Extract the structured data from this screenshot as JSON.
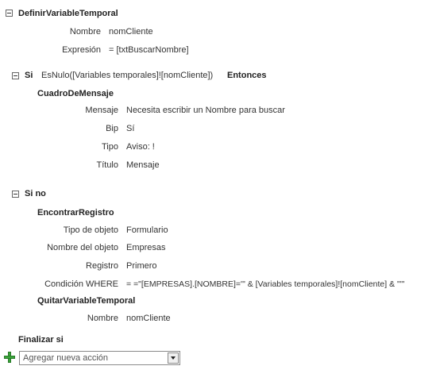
{
  "block1": {
    "action": "DefinirVariableTemporal",
    "nombre_label": "Nombre",
    "nombre_value": "nomCliente",
    "expresion_label": "Expresión",
    "expresion_value": "= [txtBuscarNombre]"
  },
  "if_block": {
    "keyword": "Si",
    "condition": "EsNulo([Variables temporales]![nomCliente])",
    "then_keyword": "Entonces",
    "action": "CuadroDeMensaje",
    "mensaje_label": "Mensaje",
    "mensaje_value": "Necesita escribir un Nombre para buscar",
    "bip_label": "Bip",
    "bip_value": "Sí",
    "tipo_label": "Tipo",
    "tipo_value": "Aviso: !",
    "titulo_label": "Título",
    "titulo_value": "Mensaje"
  },
  "else_block": {
    "keyword": "Si no",
    "action1": "EncontrarRegistro",
    "tipo_objeto_label": "Tipo de objeto",
    "tipo_objeto_value": "Formulario",
    "nombre_objeto_label": "Nombre del objeto",
    "nombre_objeto_value": "Empresas",
    "registro_label": "Registro",
    "registro_value": "Primero",
    "condicion_label": "Condición WHERE",
    "condicion_value": "= =\"[EMPRESAS].[NOMBRE]='\" & [Variables temporales]![nomCliente] & \"'\"",
    "action2": "QuitarVariableTemporal",
    "nombre_label": "Nombre",
    "nombre_value": "nomCliente"
  },
  "end_if": "Finalizar si",
  "add_action": {
    "value": "Agregar nueva acción",
    "icon": "add-icon",
    "accent_color": "#3aa53a"
  }
}
